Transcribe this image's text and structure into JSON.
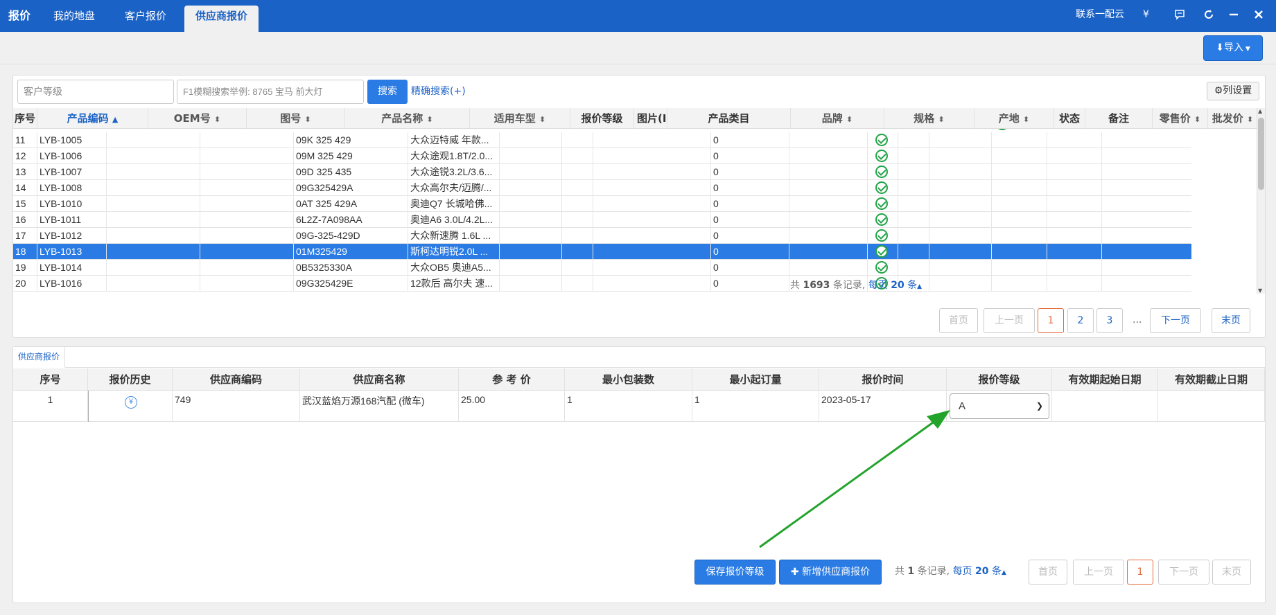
{
  "topbar": {
    "brand": "报价",
    "tabs": [
      {
        "label": "我的地盘"
      },
      {
        "label": "客户报价"
      },
      {
        "label": "供应商报价"
      }
    ],
    "contact": "联系一配云",
    "yen": "¥"
  },
  "toolbar": {
    "import_label": "导入"
  },
  "search": {
    "customer_level_placeholder": "客户等级",
    "fuzzy_placeholder": "F1模糊搜索举例: 8765 宝马 前大灯",
    "search_label": "搜索",
    "advanced_label": "精确搜索(+)",
    "column_settings_label": "列设置"
  },
  "product_grid": {
    "columns": [
      "序号",
      "产品编码",
      "OEM号",
      "图号",
      "产品名称",
      "适用车型",
      "报价等级",
      "图片(I",
      "产品类目",
      "品牌",
      "规格",
      "产地",
      "状态",
      "备注",
      "零售价",
      "批发价"
    ],
    "rows": [
      {
        "no": "11",
        "code": "LYB-1005",
        "drawing": "09K 325 429",
        "model": "大众迈特威 年款...",
        "brand": "0"
      },
      {
        "no": "12",
        "code": "LYB-1006",
        "drawing": "09M 325 429",
        "model": "大众途观1.8T/2.0...",
        "brand": "0"
      },
      {
        "no": "13",
        "code": "LYB-1007",
        "drawing": "09D 325 435",
        "model": "大众途锐3.2L/3.6...",
        "brand": "0"
      },
      {
        "no": "14",
        "code": "LYB-1008",
        "drawing": "09G325429A",
        "model": "大众高尔夫/迈腾/...",
        "brand": "0"
      },
      {
        "no": "15",
        "code": "LYB-1010",
        "drawing": "0AT 325 429A",
        "model": "奥迪Q7 长城哈佛...",
        "brand": "0"
      },
      {
        "no": "16",
        "code": "LYB-1011",
        "drawing": "6L2Z-7A098AA",
        "model": "奥迪A6 3.0L/4.2L...",
        "brand": "0"
      },
      {
        "no": "17",
        "code": "LYB-1012",
        "drawing": "09G-325-429D",
        "model": "大众新速腾 1.6L ...",
        "brand": "0"
      },
      {
        "no": "18",
        "code": "LYB-1013",
        "drawing": "01M325429",
        "model": "斯柯达明锐2.0L ...",
        "brand": "0"
      },
      {
        "no": "19",
        "code": "LYB-1014",
        "drawing": "0B5325330A",
        "model": "大众OB5 奥迪A5...",
        "brand": "0"
      },
      {
        "no": "20",
        "code": "LYB-1016",
        "drawing": "09G325429E",
        "model": "12款后 高尔夫 速...",
        "brand": "0"
      }
    ],
    "selected_row": "18"
  },
  "product_pager": {
    "total_prefix": "共",
    "total": "1693",
    "total_suffix": "条记录,",
    "per_page_prefix": "每页",
    "per_page": "20",
    "per_page_suffix": "条",
    "first": "首页",
    "prev": "上一页",
    "pages": [
      "1",
      "2",
      "3"
    ],
    "ellipsis": "...",
    "next": "下一页",
    "last": "末页"
  },
  "supplier_section": {
    "tab_label": "供应商报价",
    "columns": [
      "序号",
      "报价历史",
      "供应商编码",
      "供应商名称",
      "参 考 价",
      "最小包装数",
      "最小起订量",
      "报价时间",
      "报价等级",
      "有效期起始日期",
      "有效期截止日期"
    ],
    "row": {
      "no": "1",
      "supplier_code": "749",
      "supplier_name": "武汉蓝焰万源168汽配 (微车)",
      "ref_price": "25.00",
      "min_pack": "1",
      "min_order": "1",
      "quote_time": "2023-05-17",
      "level": "A"
    },
    "save_level_label": "保存报价等级",
    "add_quote_label": "新增供应商报价"
  },
  "supplier_pager": {
    "total_prefix": "共",
    "total": "1",
    "total_suffix": "条记录,",
    "per_page_prefix": "每页",
    "per_page": "20",
    "per_page_suffix": "条",
    "first": "首页",
    "prev": "上一页",
    "page": "1",
    "next": "下一页",
    "last": "末页"
  },
  "colors": {
    "primary": "#2a7be4",
    "topbar": "#1b62c6",
    "check": "#22a447",
    "arrow": "#22a32a"
  }
}
